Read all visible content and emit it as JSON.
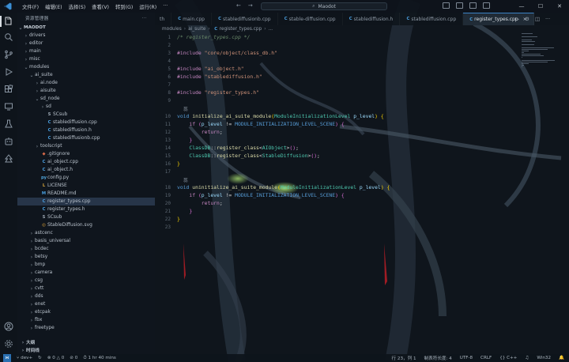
{
  "titlebar": {
    "menu": [
      "文件(F)",
      "编辑(E)",
      "选择(S)",
      "查看(V)",
      "转到(G)",
      "运行(R)",
      "···"
    ],
    "command_center": "Maodot"
  },
  "sidebar": {
    "header": "资源管理器",
    "more": "···",
    "root": "MAODOT",
    "tree": [
      {
        "label": "drivers",
        "depth": 1,
        "kind": "folder",
        "open": false
      },
      {
        "label": "editor",
        "depth": 1,
        "kind": "folder",
        "open": false
      },
      {
        "label": "main",
        "depth": 1,
        "kind": "folder",
        "open": false
      },
      {
        "label": "misc",
        "depth": 1,
        "kind": "folder",
        "open": false
      },
      {
        "label": "modules",
        "depth": 1,
        "kind": "folder",
        "open": true
      },
      {
        "label": "ai_suite",
        "depth": 2,
        "kind": "folder",
        "open": true
      },
      {
        "label": "ai.node",
        "depth": 3,
        "kind": "folder",
        "open": false
      },
      {
        "label": "aisuite",
        "depth": 3,
        "kind": "folder",
        "open": false
      },
      {
        "label": "sd_node",
        "depth": 3,
        "kind": "folder",
        "open": true
      },
      {
        "label": "sd",
        "depth": 4,
        "kind": "folder",
        "open": false
      },
      {
        "label": "SCsub",
        "depth": 4,
        "kind": "file",
        "icon": "S"
      },
      {
        "label": "stablediffusion.cpp",
        "depth": 4,
        "kind": "file",
        "icon": "C"
      },
      {
        "label": "stablediffusion.h",
        "depth": 4,
        "kind": "file",
        "icon": "C"
      },
      {
        "label": "stablediffusionb.cpp",
        "depth": 4,
        "kind": "file",
        "icon": "C"
      },
      {
        "label": "toolscript",
        "depth": 3,
        "kind": "folder",
        "open": false
      },
      {
        "label": ".gitignore",
        "depth": 3,
        "kind": "file",
        "icon": "◆"
      },
      {
        "label": "ai_object.cpp",
        "depth": 3,
        "kind": "file",
        "icon": "C"
      },
      {
        "label": "ai_object.h",
        "depth": 3,
        "kind": "file",
        "icon": "C"
      },
      {
        "label": "config.py",
        "depth": 3,
        "kind": "file",
        "icon": "py"
      },
      {
        "label": "LICENSE",
        "depth": 3,
        "kind": "file",
        "icon": "L"
      },
      {
        "label": "README.md",
        "depth": 3,
        "kind": "file",
        "icon": "M"
      },
      {
        "label": "register_types.cpp",
        "depth": 3,
        "kind": "file",
        "icon": "C",
        "selected": true
      },
      {
        "label": "register_types.h",
        "depth": 3,
        "kind": "file",
        "icon": "C"
      },
      {
        "label": "SCsub",
        "depth": 3,
        "kind": "file",
        "icon": "S"
      },
      {
        "label": "StableDiffusion.svg",
        "depth": 3,
        "kind": "file",
        "icon": "◎"
      },
      {
        "label": "astcenc",
        "depth": 2,
        "kind": "folder",
        "open": false
      },
      {
        "label": "basis_universal",
        "depth": 2,
        "kind": "folder",
        "open": false
      },
      {
        "label": "bcdec",
        "depth": 2,
        "kind": "folder",
        "open": false
      },
      {
        "label": "betsy",
        "depth": 2,
        "kind": "folder",
        "open": false
      },
      {
        "label": "bmp",
        "depth": 2,
        "kind": "folder",
        "open": false
      },
      {
        "label": "camera",
        "depth": 2,
        "kind": "folder",
        "open": false
      },
      {
        "label": "csg",
        "depth": 2,
        "kind": "folder",
        "open": false
      },
      {
        "label": "cvtt",
        "depth": 2,
        "kind": "folder",
        "open": false
      },
      {
        "label": "dds",
        "depth": 2,
        "kind": "folder",
        "open": false
      },
      {
        "label": "enet",
        "depth": 2,
        "kind": "folder",
        "open": false
      },
      {
        "label": "etcpak",
        "depth": 2,
        "kind": "folder",
        "open": false
      },
      {
        "label": "fbx",
        "depth": 2,
        "kind": "folder",
        "open": false
      },
      {
        "label": "freetype",
        "depth": 2,
        "kind": "folder",
        "open": false
      }
    ],
    "outline_label": "大纲",
    "timeline_label": "时间线"
  },
  "tabs": [
    {
      "label": "th",
      "icon": "",
      "active": false
    },
    {
      "label": "main.cpp",
      "icon": "C",
      "active": false
    },
    {
      "label": "stablediffusionb.cpp",
      "icon": "C",
      "active": false
    },
    {
      "label": "stable-diffusion.cpp",
      "icon": "C",
      "active": false
    },
    {
      "label": "stablediffusion.h",
      "icon": "C",
      "active": false
    },
    {
      "label": "stablediffusion.cpp",
      "icon": "C",
      "active": false
    },
    {
      "label": "register_types.cpp",
      "icon": "C",
      "active": true,
      "close": "×"
    }
  ],
  "breadcrumb": [
    "modules",
    "ai_suite",
    "register_types.cpp",
    "..."
  ],
  "code_lens": [
    "蕊",
    "蕊"
  ],
  "code_lines": [
    {
      "n": "1",
      "tokens": [
        [
          "comment",
          "/* register_types.cpp */"
        ]
      ]
    },
    {
      "n": "2",
      "tokens": []
    },
    {
      "n": "3",
      "tokens": [
        [
          "directive",
          "#include "
        ],
        [
          "string",
          "\"core/object/class_db.h\""
        ]
      ]
    },
    {
      "n": "4",
      "tokens": []
    },
    {
      "n": "5",
      "tokens": [
        [
          "directive",
          "#include "
        ],
        [
          "string",
          "\"ai_object.h\""
        ]
      ]
    },
    {
      "n": "6",
      "tokens": [
        [
          "directive",
          "#include "
        ],
        [
          "string",
          "\"stablediffusion.h\""
        ]
      ]
    },
    {
      "n": "7",
      "tokens": []
    },
    {
      "n": "8",
      "tokens": [
        [
          "directive",
          "#include "
        ],
        [
          "string",
          "\"register_types.h\""
        ]
      ]
    },
    {
      "n": "9",
      "tokens": []
    },
    {
      "n": "10",
      "tokens": [
        [
          "type",
          "void "
        ],
        [
          "func",
          "initialize_ai_suite_module"
        ],
        [
          "brace",
          "("
        ],
        [
          "class",
          "ModuleInitializationLevel "
        ],
        [
          "param",
          "p_level"
        ],
        [
          "brace",
          ")"
        ],
        [
          "punct",
          " "
        ],
        [
          "brace",
          "{"
        ]
      ]
    },
    {
      "n": "11",
      "tokens": [
        [
          "kw",
          "    if "
        ],
        [
          "brace2",
          "("
        ],
        [
          "param",
          "p_level"
        ],
        [
          "punct",
          " != "
        ],
        [
          "macro",
          "MODULE_INITIALIZATION_LEVEL_SCENE"
        ],
        [
          "brace2",
          ")"
        ],
        [
          "punct",
          " "
        ],
        [
          "brace2",
          "{"
        ]
      ]
    },
    {
      "n": "12",
      "tokens": [
        [
          "kw",
          "        return"
        ],
        [
          "punct",
          ";"
        ]
      ]
    },
    {
      "n": "13",
      "tokens": [
        [
          "brace2",
          "    }"
        ]
      ]
    },
    {
      "n": "14",
      "tokens": [
        [
          "class",
          "    ClassDB"
        ],
        [
          "punct",
          "::"
        ],
        [
          "func",
          "register_class"
        ],
        [
          "punct",
          "<"
        ],
        [
          "class",
          "AIObject"
        ],
        [
          "punct",
          ">"
        ],
        [
          "brace2",
          "()"
        ],
        [
          "punct",
          ";"
        ]
      ]
    },
    {
      "n": "15",
      "tokens": [
        [
          "class",
          "    ClassDB"
        ],
        [
          "punct",
          "::"
        ],
        [
          "func",
          "register_class"
        ],
        [
          "punct",
          "<"
        ],
        [
          "class",
          "StableDiffusion"
        ],
        [
          "punct",
          ">"
        ],
        [
          "brace2",
          "()"
        ],
        [
          "punct",
          ";"
        ]
      ]
    },
    {
      "n": "16",
      "tokens": [
        [
          "brace",
          "}"
        ]
      ]
    },
    {
      "n": "17",
      "tokens": []
    },
    {
      "n": "18",
      "tokens": [
        [
          "type",
          "void "
        ],
        [
          "func",
          "uninitialize_ai_suite_module"
        ],
        [
          "brace",
          "("
        ],
        [
          "class",
          "ModuleInitializationLevel "
        ],
        [
          "param",
          "p_level"
        ],
        [
          "brace",
          ")"
        ],
        [
          "punct",
          " "
        ],
        [
          "brace",
          "{"
        ]
      ]
    },
    {
      "n": "19",
      "tokens": [
        [
          "kw",
          "    if "
        ],
        [
          "brace2",
          "("
        ],
        [
          "param",
          "p_level"
        ],
        [
          "punct",
          " != "
        ],
        [
          "macro",
          "MODULE_INITIALIZATION_LEVEL_SCENE"
        ],
        [
          "brace2",
          ")"
        ],
        [
          "punct",
          " "
        ],
        [
          "brace2",
          "{"
        ]
      ]
    },
    {
      "n": "20",
      "tokens": [
        [
          "kw",
          "        return"
        ],
        [
          "punct",
          ";"
        ]
      ]
    },
    {
      "n": "21",
      "tokens": [
        [
          "brace2",
          "    }"
        ]
      ]
    },
    {
      "n": "22",
      "tokens": [
        [
          "brace",
          "}"
        ]
      ]
    },
    {
      "n": "23",
      "tokens": []
    }
  ],
  "statusbar": {
    "branch": "dev+",
    "errors": "0",
    "warnings": "0",
    "ports": "0",
    "time": "1 hr 40 mins",
    "position": "行 23，列 1",
    "indent": "制表符长度: 4",
    "encoding": "UTF-8",
    "eol": "CRLF",
    "language": "C++",
    "platform": "Win32"
  },
  "colors": {
    "accent": "#3b82c4",
    "selection": "#3c506e"
  }
}
